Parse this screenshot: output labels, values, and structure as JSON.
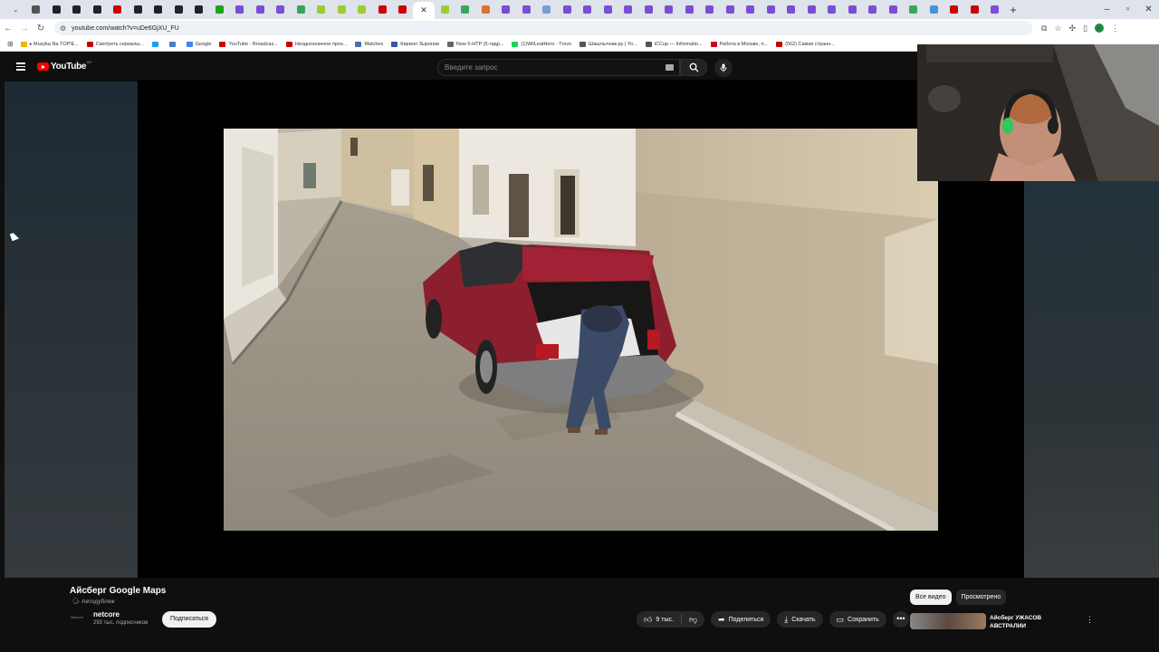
{
  "browser": {
    "url": "youtube.com/watch?v=uDe6GjXU_FU",
    "tab_favicon_colors": [
      "#555555",
      "#222222",
      "#222222",
      "#222222",
      "#cc0000",
      "#222222",
      "#222222",
      "#222222",
      "#222222",
      "#1aa21a",
      "#7b4dd6",
      "#7b4dd6",
      "#7b4dd6",
      "#3aa55a",
      "#9acd32",
      "#9acd32",
      "#9acd32",
      "#cc0000",
      "#cc0000"
    ],
    "active_tab_close": "✕",
    "more_tab_favicon_colors": [
      "#9acd32",
      "#3aa55a",
      "#e07030",
      "#7b4dd6",
      "#7b4dd6",
      "#7b9bd6",
      "#7b4dd6",
      "#7b4dd6",
      "#7b4dd6",
      "#7b4dd6",
      "#7b4dd6",
      "#7b4dd6",
      "#7b4dd6",
      "#7b4dd6",
      "#7b4dd6",
      "#7b4dd6",
      "#7b4dd6",
      "#7b4dd6",
      "#7b4dd6",
      "#7b4dd6",
      "#7b4dd6",
      "#7b4dd6",
      "#7b4dd6",
      "#3aa55a",
      "#4a90e2",
      "#cc0000",
      "#cc0000",
      "#7b4dd6"
    ],
    "new_tab": "+",
    "window_controls": {
      "minimize": "–",
      "restore": "▫",
      "close": "✕"
    },
    "profile_initial": "K",
    "bookmarks": [
      {
        "label": "▸ Muzyka Na TOP!E...",
        "color": "#f4b400"
      },
      {
        "label": "Смотреть сериалы...",
        "color": "#cc0000"
      },
      {
        "label": "",
        "color": "#1da1f2"
      },
      {
        "label": "",
        "color": "#4680c2"
      },
      {
        "label": "Google",
        "color": "#4285f4"
      },
      {
        "label": "YouTube - Broadcas...",
        "color": "#cc0000"
      },
      {
        "label": "Неоднозначное прох...",
        "color": "#cc0000"
      },
      {
        "label": "Matches",
        "color": "#4a6fa5"
      },
      {
        "label": "Кирилл Зырянов",
        "color": "#3b5998"
      },
      {
        "label": "Now 5-HTP (5-гидр...",
        "color": "#666666"
      },
      {
        "label": "(1)WilLeatHero - Trovo",
        "color": "#19d65b"
      },
      {
        "label": "Шашлычник.ру | Yo...",
        "color": "#555555"
      },
      {
        "label": "iCCup — Informatio...",
        "color": "#555555"
      },
      {
        "label": "Работа в Москве, п...",
        "color": "#d6001c"
      },
      {
        "label": "(562) Самая странн...",
        "color": "#cc0000"
      }
    ]
  },
  "youtube": {
    "logo_text": "YouTube",
    "logo_country": "BY",
    "search_placeholder": "Введите запрос",
    "video_title": "Айсберг Google Maps",
    "video_tag": "Автодубляж",
    "channel_avatar_text": "Netcore",
    "channel_name": "netcore",
    "subscribers": "293 тыс. подписчиков",
    "subscribe_label": "Подписаться",
    "likes": "9 тыс.",
    "share_label": "Поделиться",
    "download_label": "Скачать",
    "save_label": "Сохранить",
    "more_label": "•••",
    "chips": [
      "Все видео",
      "Просмотрено"
    ],
    "recommended_title": "Айсберг УЖАСОВ АВСТРАЛИИ",
    "recommended_menu": "⋮"
  }
}
